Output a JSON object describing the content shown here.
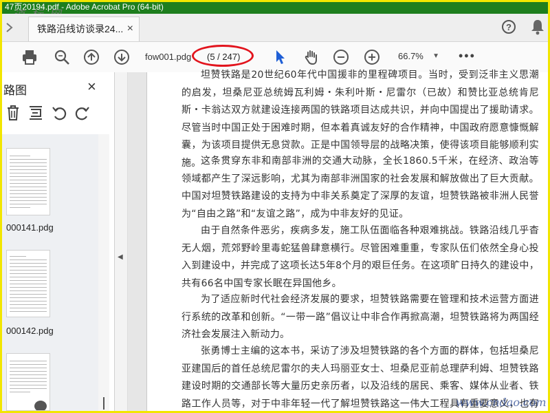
{
  "app": {
    "title": "47页20194.pdf - Adobe Acrobat Pro (64-bit)",
    "watermark_top": "道 标 网",
    "watermark_bottom": "www.cndao.com"
  },
  "tab": {
    "label": "铁路沿线访谈录24...",
    "close": "×"
  },
  "header_icons": {
    "help": "?",
    "help_icon": "help-circle-icon",
    "bell_icon": "bell-icon"
  },
  "toolbar": {
    "icons": [
      "print-icon",
      "zoom-search-icon",
      "page-up-icon",
      "page-down-icon",
      "pointer-icon",
      "hand-icon",
      "zoom-out-icon",
      "zoom-in-icon",
      "more-icon"
    ],
    "filename": "fow001.pdg",
    "page_count": "(5 / 247)",
    "zoom": "66.7%",
    "more": "•••",
    "highlight_color": "#e2141d"
  },
  "sidebar": {
    "title": "路图",
    "close": "×",
    "tools": [
      "delete-icon",
      "extract-icon",
      "rotate-left-icon",
      "rotate-right-icon"
    ],
    "thumbnails": [
      {
        "label": "000141.pdg"
      },
      {
        "label": "000142.pdg"
      },
      {
        "label": ""
      }
    ]
  },
  "document": {
    "paragraphs": [
      "坦赞铁路是20世纪60年代中国援非的里程碑项目。当时，受到泛非主义思潮的启发，坦桑尼亚总统姆瓦利姆・朱利叶斯・尼雷尔（已故）和赞比亚总统肯尼斯・卡翁达双方就建设连接两国的铁路项目达成共识，并向中国提出了援助请求。尽管当时中国正处于困难时期，但本着真诚友好的合作精神，中国政府愿意慷慨解囊，为该项目提供无息贷款。正是中国领导层的战略决策，使得该项目能够顺利实施。",
      "这条贯穿东非和南部非洲的交通大动脉，全长1860.5千米，在经济、政治等领域都产生了深远影响，尤其为南部非洲国家的社会发展和解放做出了巨大贡献。中国对坦赞铁路建设的支持为中非关系奠定了深厚的友谊，坦赞铁路被非洲人民誉为“自由之路”和“友谊之路”，成为中非友好的见证。",
      "由于自然条件恶劣，疾病多发，施工队伍面临各种艰难挑战。铁路沿线几乎杳无人烟，荒郊野岭里毒蛇猛兽肆意横行。尽管困难重重，专家队伍们依然全身心投入到建设中，并完成了这项长达5年8个月的艰巨任务。在这项旷日持久的建设中，共有66名中国专家长眠在异国他乡。",
      "为了适应新时代社会经济发展的要求，坦赞铁路需要在管理和技术运营方面进行系统的改革和创新。“一带一路”倡议让中非合作再掀高潮，坦赞铁路将为两国经济社会发展注入新动力。",
      "张勇博士主编的这本书，采访了涉及坦赞铁路的各个方面的群体，包括坦桑尼亚建国后的首任总统尼雷尔的夫人玛丽亚女士、坦桑尼亚前总理萨利姆、坦赞铁路建设时期的交通部长等大量历史亲历者，以及沿线的居民、乘客、媒体从业者、铁路工作人员等，对于中非年轻一代了解坦赞铁路这一伟大工程具有重要意义，也有利于中坦关系的"
    ]
  }
}
